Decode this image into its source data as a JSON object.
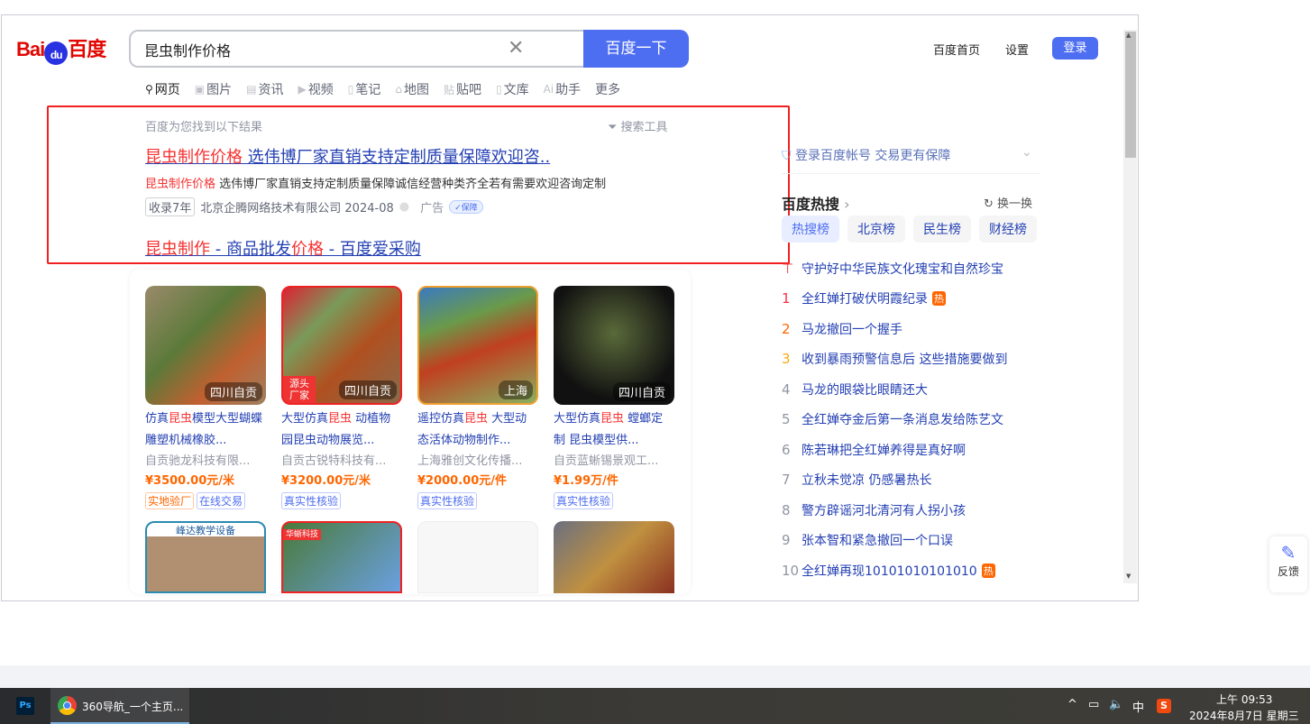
{
  "header": {
    "logo": "Bai百度",
    "query": "昆虫制作价格",
    "search_button": "百度一下",
    "home_link": "百度首页",
    "settings_link": "设置",
    "login_button": "登录"
  },
  "nav": [
    "网页",
    "图片",
    "资讯",
    "视频",
    "笔记",
    "地图",
    "贴吧",
    "文库",
    "助手",
    "更多"
  ],
  "results": {
    "hint": "百度为您找到以下结果",
    "tools": "搜索工具",
    "r1": {
      "title_red": "昆虫制作价格",
      "title_rest": " 选伟博厂家直销支持定制质量保障欢迎咨..",
      "desc_red": "昆虫制作价格",
      "desc_rest": " 选伟博厂家直销支持定制质量保障诚信经营种类齐全若有需要欢迎咨询定制",
      "badge": "收录7年",
      "company": "北京企腾网络技术有限公司 2024-08",
      "ad": "广告",
      "guarantee": "保障"
    },
    "r2": {
      "p1": "昆虫制作",
      "p2": " - 商品批发",
      "p3": "价格",
      "p4": " - 百度爱采购"
    }
  },
  "products": [
    {
      "t1": "仿真",
      "t2": "昆虫",
      "t3": "模型大型蝴蝶雕塑机械橡胶...",
      "company": "自贡驰龙科技有限...",
      "price": "¥3500.00元/米",
      "location": "四川自贡",
      "tags": [
        "实地验厂",
        "在线交易"
      ]
    },
    {
      "t1": "大型仿真",
      "t2": "昆虫",
      "t3": " 动植物园昆虫动物展览...",
      "company": "自贡古锐特科技有...",
      "price": "¥3200.00元/米",
      "location": "四川自贡",
      "source": "源头厂家",
      "tags": [
        "真实性核验"
      ]
    },
    {
      "t1": "遥控仿真",
      "t2": "昆虫",
      "t3": " 大型动态活体动物制作...",
      "company": "上海雅创文化传播...",
      "price": "¥2000.00元/件",
      "location": "上海",
      "tags": [
        "真实性核验"
      ]
    },
    {
      "t1": "大型仿真",
      "t2": "昆虫",
      "t3": " 螳螂定制 昆虫模型供...",
      "company": "自贡蓝蜥锡景观工...",
      "price": "¥1.99万/件",
      "location": "四川自贡",
      "tags": [
        "真实性核验"
      ]
    }
  ],
  "row2_labels": [
    "峰达教学设备",
    "华蜥科技"
  ],
  "sidebar": {
    "login_prompt": "登录百度帐号 交易更有保障",
    "hot_title": "百度热搜",
    "refresh": "换一换",
    "tabs": [
      "热搜榜",
      "北京榜",
      "民生榜",
      "财经榜"
    ],
    "hot": [
      {
        "rank": "",
        "title": "守护好中华民族文化瑰宝和自然珍宝",
        "hot": ""
      },
      {
        "rank": "1",
        "title": "全红婵打破伏明霞纪录",
        "hot": "热"
      },
      {
        "rank": "2",
        "title": "马龙撤回一个握手",
        "hot": ""
      },
      {
        "rank": "3",
        "title": "收到暴雨预警信息后 这些措施要做到",
        "hot": ""
      },
      {
        "rank": "4",
        "title": "马龙的眼袋比眼睛还大",
        "hot": ""
      },
      {
        "rank": "5",
        "title": "全红婵夺金后第一条消息发给陈艺文",
        "hot": ""
      },
      {
        "rank": "6",
        "title": "陈若琳把全红婵养得是真好啊",
        "hot": ""
      },
      {
        "rank": "7",
        "title": "立秋未觉凉 仍感暑热长",
        "hot": ""
      },
      {
        "rank": "8",
        "title": "警方辟谣河北清河有人拐小孩",
        "hot": ""
      },
      {
        "rank": "9",
        "title": "张本智和紧急撤回一个口误",
        "hot": ""
      },
      {
        "rank": "10",
        "title": "全红婵再现10101010101010",
        "hot": "热"
      }
    ]
  },
  "feedback": "反馈",
  "taskbar": {
    "ps": "Ps",
    "chrome_title": "360导航_一个主页...",
    "ime": "中",
    "time": "上午 09:53",
    "date": "2024年8月7日 星期三"
  }
}
